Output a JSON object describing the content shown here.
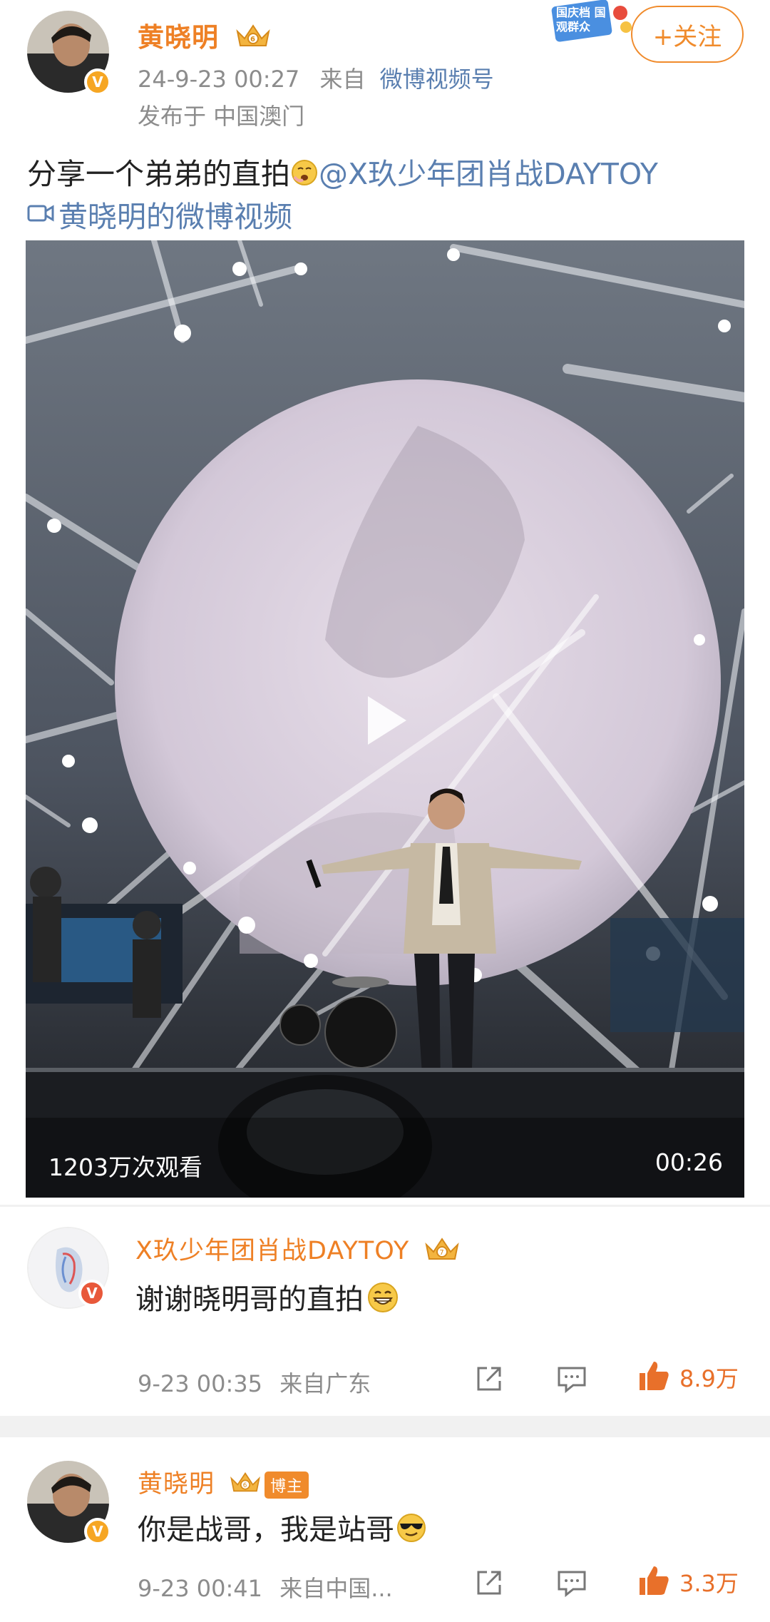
{
  "post": {
    "author": "黄晓明",
    "time": "24-9-23 00:27",
    "source_prefix": "来自",
    "source": "微博视频号",
    "location": "发布于 中国澳门",
    "follow_label": "+关注",
    "promo_text": "国庆档 国观群众",
    "text": "分享一个弟弟的直拍",
    "mention": "@X玖少年团肖战DAYTOY",
    "video_link": "黄晓明的微博视频",
    "video": {
      "views": "1203万次观看",
      "duration": "00:26"
    }
  },
  "comments": [
    {
      "author": "X玖少年团肖战DAYTOY",
      "text": "谢谢晓明哥的直拍",
      "time": "9-23 00:35",
      "source": "来自广东",
      "likes": "8.9万"
    },
    {
      "author": "黄晓明",
      "badge": "博主",
      "text": "你是战哥，我是站哥",
      "time": "9-23 00:41",
      "source": "来自中国...",
      "likes": "3.3万"
    }
  ],
  "colors": {
    "name": "#ee8025",
    "link": "#5a7fb0",
    "meta": "#8c8c8c",
    "like": "#e8702a"
  },
  "icons": [
    "verified-v-icon",
    "crown-icon",
    "video-camera-icon",
    "play-icon",
    "share-icon",
    "comment-icon",
    "like-icon",
    "grin-emoji-icon",
    "sunglasses-emoji-icon",
    "yawn-emoji-icon"
  ]
}
